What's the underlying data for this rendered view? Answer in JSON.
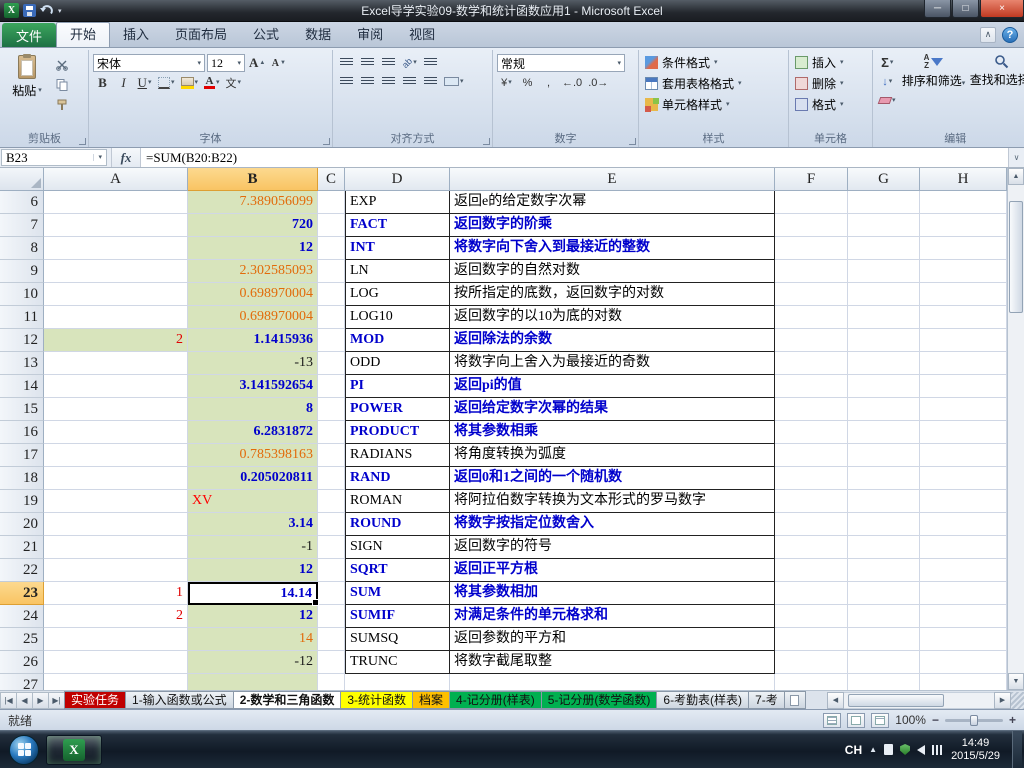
{
  "window": {
    "title": "Excel导学实验09-数学和统计函数应用1 - Microsoft Excel"
  },
  "icons": {
    "minimize": "─",
    "maximize": "□",
    "close": "×",
    "save": "disk",
    "undo": "arc-arrow",
    "cut": "scissors",
    "copy": "pages",
    "format_painter": "brush",
    "autosum": "Σ",
    "sort": "AZ-funnel",
    "find": "magnifier",
    "dropdown": "▾"
  },
  "ribbon": {
    "file_tab": "文件",
    "tabs": [
      {
        "label": "开始",
        "active": true
      },
      {
        "label": "插入"
      },
      {
        "label": "页面布局"
      },
      {
        "label": "公式"
      },
      {
        "label": "数据"
      },
      {
        "label": "审阅"
      },
      {
        "label": "视图"
      }
    ],
    "clipboard": {
      "label": "剪贴板",
      "paste": "粘贴"
    },
    "font": {
      "label": "字体",
      "font_name": "宋体",
      "font_size": "12",
      "bold": "B",
      "italic": "I",
      "underline": "U"
    },
    "alignment": {
      "label": "对齐方式"
    },
    "number": {
      "label": "数字",
      "format": "常规"
    },
    "styles": {
      "label": "样式",
      "items": [
        "条件格式",
        "套用表格格式",
        "单元格样式"
      ]
    },
    "cells": {
      "label": "单元格",
      "items": [
        "插入",
        "删除",
        "格式"
      ]
    },
    "editing": {
      "label": "编辑",
      "autosum": "Σ",
      "sort": "排序和筛选",
      "find": "查找和选择"
    }
  },
  "formula_bar": {
    "name_box": "B23",
    "fx": "fx",
    "formula": "=SUM(B20:B22)"
  },
  "grid": {
    "columns": [
      "A",
      "B",
      "C",
      "D",
      "E",
      "F",
      "G",
      "H"
    ],
    "selected_column": "B",
    "selected_row": 23,
    "rows": [
      {
        "n": 6,
        "a": "",
        "b": "7.389056099",
        "b_class": "orange",
        "d": "EXP",
        "e": "返回e的给定数字次幂",
        "de_class": "plain"
      },
      {
        "n": 7,
        "a": "",
        "b": "720",
        "b_class": "blue",
        "d": "FACT",
        "e": "返回数字的阶乘",
        "de_class": "blue"
      },
      {
        "n": 8,
        "a": "",
        "b": "12",
        "b_class": "blue",
        "d": "INT",
        "e": "将数字向下舍入到最接近的整数",
        "de_class": "blue"
      },
      {
        "n": 9,
        "a": "",
        "b": "2.302585093",
        "b_class": "orange",
        "d": "LN",
        "e": "返回数字的自然对数",
        "de_class": "plain"
      },
      {
        "n": 10,
        "a": "",
        "b": "0.698970004",
        "b_class": "orange",
        "d": "LOG",
        "e": "按所指定的底数，返回数字的对数",
        "de_class": "plain"
      },
      {
        "n": 11,
        "a": "",
        "b": "0.698970004",
        "b_class": "orange",
        "d": "LOG10",
        "e": "返回数字的以10为底的对数",
        "de_class": "plain"
      },
      {
        "n": 12,
        "a": "2",
        "a_fill": true,
        "b": "1.1415936",
        "b_class": "blue",
        "d": "MOD",
        "e": "返回除法的余数",
        "de_class": "blue"
      },
      {
        "n": 13,
        "a": "",
        "b": "-13",
        "b_class": "dark",
        "d": "ODD",
        "e": "将数字向上舍入为最接近的奇数",
        "de_class": "plain"
      },
      {
        "n": 14,
        "a": "",
        "b": "3.141592654",
        "b_class": "blue",
        "d": "PI",
        "e": "返回pi的值",
        "de_class": "blue"
      },
      {
        "n": 15,
        "a": "",
        "b": "8",
        "b_class": "blue",
        "d": "POWER",
        "e": "返回给定数字次幂的结果",
        "de_class": "blue"
      },
      {
        "n": 16,
        "a": "",
        "b": "6.2831872",
        "b_class": "blue",
        "d": "PRODUCT",
        "e": "将其参数相乘",
        "de_class": "blue"
      },
      {
        "n": 17,
        "a": "",
        "b": "0.785398163",
        "b_class": "orange",
        "d": "RADIANS",
        "e": "将角度转换为弧度",
        "de_class": "plain"
      },
      {
        "n": 18,
        "a": "",
        "b": "0.205020811",
        "b_class": "blue",
        "d": "RAND",
        "e": "返回0和1之间的一个随机数",
        "de_class": "blue"
      },
      {
        "n": 19,
        "a": "",
        "b": "XV",
        "b_class": "red-left",
        "d": "ROMAN",
        "e": "将阿拉伯数字转换为文本形式的罗马数字",
        "de_class": "plain"
      },
      {
        "n": 20,
        "a": "",
        "b": "3.14",
        "b_class": "blue",
        "d": "ROUND",
        "e": "将数字按指定位数舍入",
        "de_class": "blue"
      },
      {
        "n": 21,
        "a": "",
        "b": "-1",
        "b_class": "dark",
        "d": "SIGN",
        "e": "返回数字的符号",
        "de_class": "plain"
      },
      {
        "n": 22,
        "a": "",
        "b": "12",
        "b_class": "blue",
        "d": "SQRT",
        "e": "返回正平方根",
        "de_class": "blue"
      },
      {
        "n": 23,
        "a": "1",
        "b": "14.14",
        "b_class": "blue",
        "d": "SUM",
        "e": "将其参数相加",
        "de_class": "blue"
      },
      {
        "n": 24,
        "a": "2",
        "b": "12",
        "b_class": "blue",
        "d": "SUMIF",
        "e": "对满足条件的单元格求和",
        "de_class": "blue"
      },
      {
        "n": 25,
        "a": "",
        "b": "14",
        "b_class": "orange",
        "d": "SUMSQ",
        "e": "返回参数的平方和",
        "de_class": "plain"
      },
      {
        "n": 26,
        "a": "",
        "b": "-12",
        "b_class": "dark",
        "d": "TRUNC",
        "e": "将数字截尾取整",
        "de_class": "plain"
      },
      {
        "n": 27,
        "a": "",
        "b": "",
        "b_class": "plain",
        "d": "",
        "e": "",
        "de_class": "plain"
      }
    ]
  },
  "sheet_tabs": [
    {
      "label": "实验任务",
      "color": "red"
    },
    {
      "label": "1-输入函数或公式",
      "color": "plain"
    },
    {
      "label": "2-数学和三角函数",
      "color": "active"
    },
    {
      "label": "3-统计函数",
      "color": "yellow"
    },
    {
      "label": "档案",
      "color": "orange"
    },
    {
      "label": "4-记分册(样表)",
      "color": "green"
    },
    {
      "label": "5-记分册(数学函数)",
      "color": "green"
    },
    {
      "label": "6-考勤表(样表)",
      "color": "plain"
    },
    {
      "label": "7-考",
      "color": "plain"
    }
  ],
  "status_bar": {
    "ready": "就绪",
    "zoom": "100%"
  },
  "taskbar": {
    "ime": "CH",
    "time": "14:49",
    "date": "2015/5/29"
  }
}
